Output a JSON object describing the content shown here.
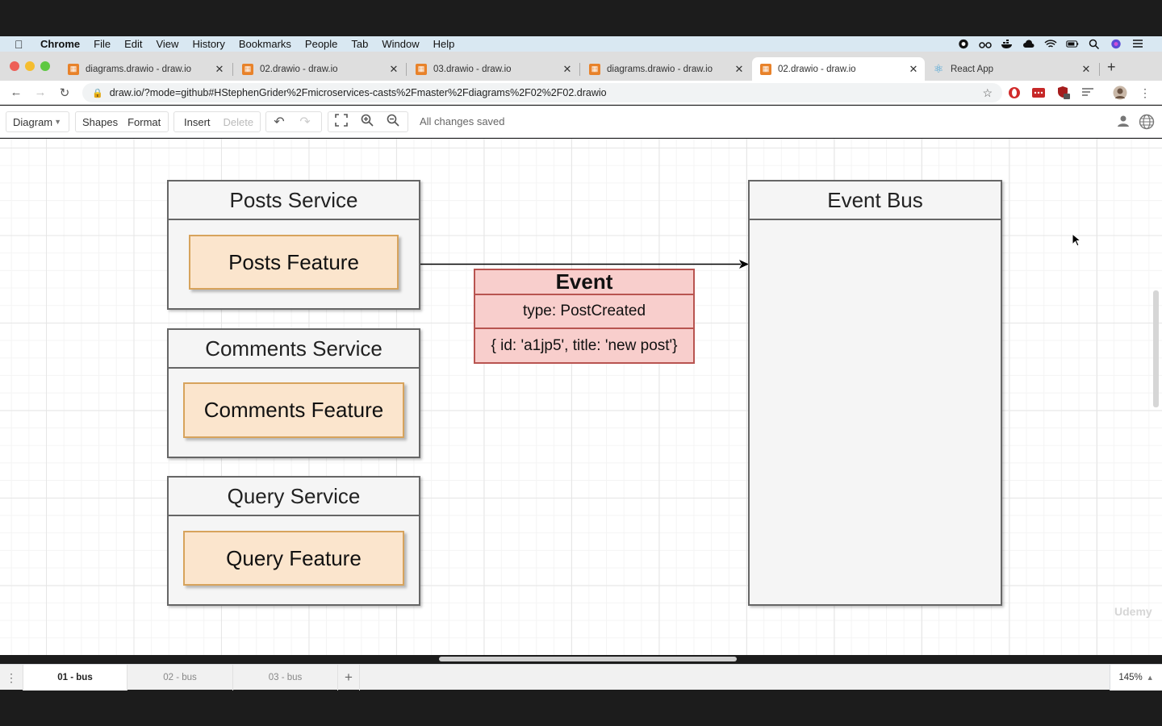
{
  "menubar": {
    "app_name": "Chrome",
    "items": [
      "File",
      "Edit",
      "View",
      "History",
      "Bookmarks",
      "People",
      "Tab",
      "Window",
      "Help"
    ]
  },
  "tabs": [
    {
      "label": "diagrams.drawio - draw.io",
      "active": false
    },
    {
      "label": "02.drawio - draw.io",
      "active": false
    },
    {
      "label": "03.drawio - draw.io",
      "active": false
    },
    {
      "label": "diagrams.drawio - draw.io",
      "active": false
    },
    {
      "label": "02.drawio - draw.io",
      "active": true
    },
    {
      "label": "React App",
      "active": false
    }
  ],
  "address": {
    "url": "draw.io/?mode=github#HStephenGrider%2Fmicroservices-casts%2Fmaster%2Fdiagrams%2F02%2F02.drawio"
  },
  "toolbar": {
    "diagram_label": "Diagram",
    "shapes_label": "Shapes",
    "format_label": "Format",
    "insert_label": "Insert",
    "delete_label": "Delete",
    "status": "All changes saved"
  },
  "diagram": {
    "services": [
      {
        "title": "Posts Service",
        "feature": "Posts Feature"
      },
      {
        "title": "Comments Service",
        "feature": "Comments Feature"
      },
      {
        "title": "Query Service",
        "feature": "Query Feature"
      }
    ],
    "event_bus": {
      "title": "Event Bus"
    },
    "event": {
      "title": "Event",
      "type_line": "type: PostCreated",
      "payload_line": "{ id: 'a1jp5', title: 'new post'}"
    },
    "watermark": "Udemy"
  },
  "pages": {
    "tabs": [
      "01 - bus",
      "02 - bus",
      "03 - bus"
    ],
    "active_index": 0,
    "zoom": "145%"
  },
  "colors": {
    "feature_fill": "#fbe5cd",
    "feature_stroke": "#d7a35c",
    "event_fill": "#f8cecc",
    "event_stroke": "#b85450",
    "service_fill": "#f5f5f5"
  }
}
